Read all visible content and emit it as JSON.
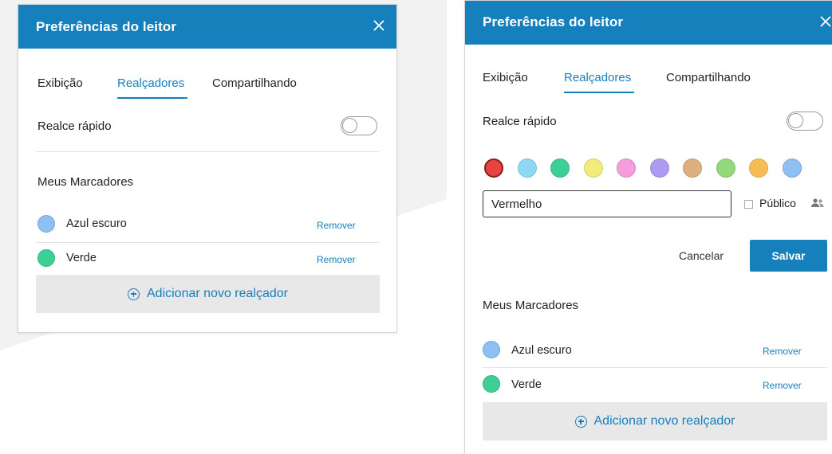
{
  "colors": {
    "brand": "#1680bd",
    "button_bg": "#e8e8e8"
  },
  "left_panel": {
    "title": "Preferências do leitor",
    "close_icon": "close-icon",
    "tabs": [
      {
        "label": "Exibição",
        "active": false
      },
      {
        "label": "Realçadores",
        "active": true
      },
      {
        "label": "Compartilhando",
        "active": false
      }
    ],
    "quick_highlight": {
      "label": "Realce rápido",
      "enabled": false
    },
    "markers_heading": "Meus Marcadores",
    "markers": [
      {
        "name": "Azul escuro",
        "color": "#8ec0f2",
        "remove_label": "Remover"
      },
      {
        "name": "Verde",
        "color": "#3ecf95",
        "remove_label": "Remover"
      }
    ],
    "add_button_label": "Adicionar novo realçador"
  },
  "right_panel": {
    "title": "Preferências do leitor",
    "close_icon": "close-icon",
    "tabs": [
      {
        "label": "Exibição",
        "active": false
      },
      {
        "label": "Realçadores",
        "active": true
      },
      {
        "label": "Compartilhando",
        "active": false
      }
    ],
    "quick_highlight": {
      "label": "Realce rápido",
      "enabled": false
    },
    "palette": [
      {
        "name": "red",
        "color": "#e8433f",
        "selected": true
      },
      {
        "name": "light-blue",
        "color": "#8fd8f4",
        "selected": false
      },
      {
        "name": "green",
        "color": "#3ecf95",
        "selected": false
      },
      {
        "name": "yellow",
        "color": "#f1ec7c",
        "selected": false
      },
      {
        "name": "pink",
        "color": "#f59ddd",
        "selected": false
      },
      {
        "name": "purple",
        "color": "#ad9cf2",
        "selected": false
      },
      {
        "name": "tan",
        "color": "#ddb07e",
        "selected": false
      },
      {
        "name": "light-green",
        "color": "#93d87a",
        "selected": false
      },
      {
        "name": "orange",
        "color": "#f8bd52",
        "selected": false
      },
      {
        "name": "blue",
        "color": "#8ec0f2",
        "selected": false
      }
    ],
    "name_input_value": "Vermelho",
    "public_label": "Público",
    "public_icon": "users-icon",
    "cancel_label": "Cancelar",
    "save_label": "Salvar",
    "markers_heading": "Meus Marcadores",
    "markers": [
      {
        "name": "Azul escuro",
        "color": "#8ec0f2",
        "remove_label": "Remover"
      },
      {
        "name": "Verde",
        "color": "#3ecf95",
        "remove_label": "Remover"
      }
    ],
    "add_button_label": "Adicionar novo realçador"
  }
}
